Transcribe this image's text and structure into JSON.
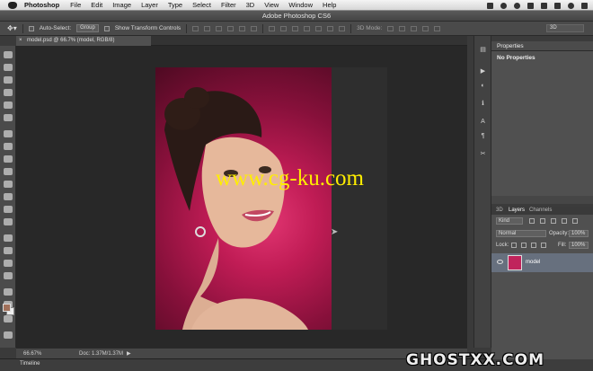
{
  "menubar": {
    "app_name": "Photoshop",
    "items": [
      "File",
      "Edit",
      "Image",
      "Layer",
      "Type",
      "Select",
      "Filter",
      "3D",
      "View",
      "Window",
      "Help"
    ],
    "status_icons": [
      "dropbox-icon",
      "sync-icon",
      "clock-icon",
      "wifi-icon",
      "volume-icon",
      "battery-icon",
      "search-icon",
      "list-icon"
    ]
  },
  "window": {
    "title": "Adobe Photoshop CS6"
  },
  "options": {
    "auto_select_label": "Auto-Select:",
    "auto_select_value": "Group",
    "show_transform_label": "Show Transform Controls",
    "mode_3d_label": "3D Mode:",
    "workspace": "3D"
  },
  "document": {
    "tab_label": "model.psd @ 66.7% (model, RGB/8)",
    "close_glyph": "×",
    "zoom": "66.67%",
    "doc_size": "Doc: 1.37M/1.37M",
    "status_arrow": "▶"
  },
  "tools": [
    "move-tool-icon",
    "marquee-tool-icon",
    "lasso-tool-icon",
    "quick-select-tool-icon",
    "crop-tool-icon",
    "eyedropper-tool-icon",
    "healing-brush-icon",
    "brush-tool-icon",
    "clone-stamp-icon",
    "history-brush-icon",
    "eraser-tool-icon",
    "gradient-tool-icon",
    "blur-tool-icon",
    "dodge-tool-icon",
    "pen-tool-icon",
    "type-tool-icon",
    "path-select-icon",
    "shape-tool-icon",
    "hand-tool-icon",
    "zoom-tool-icon"
  ],
  "colors": {
    "foreground": "#a1705a",
    "background": "#eeeeee",
    "canvas_bg": "#c01c55",
    "accent_layer": "#67707e"
  },
  "watermark": "www.cg-ku.com",
  "footer_mark": "GHOSTXX.COM",
  "panels": {
    "properties_tab": "Properties",
    "no_properties": "No Properties",
    "layer_tabs": [
      "3D",
      "Layers",
      "Channels"
    ],
    "kind_label": "Kind",
    "blend_mode": "Normal",
    "opacity_label": "Opacity:",
    "opacity_value": "100%",
    "lock_label": "Lock:",
    "fill_label": "Fill:",
    "fill_value": "100%",
    "layer_name": "model"
  },
  "timeline": {
    "tab": "Timeline"
  }
}
